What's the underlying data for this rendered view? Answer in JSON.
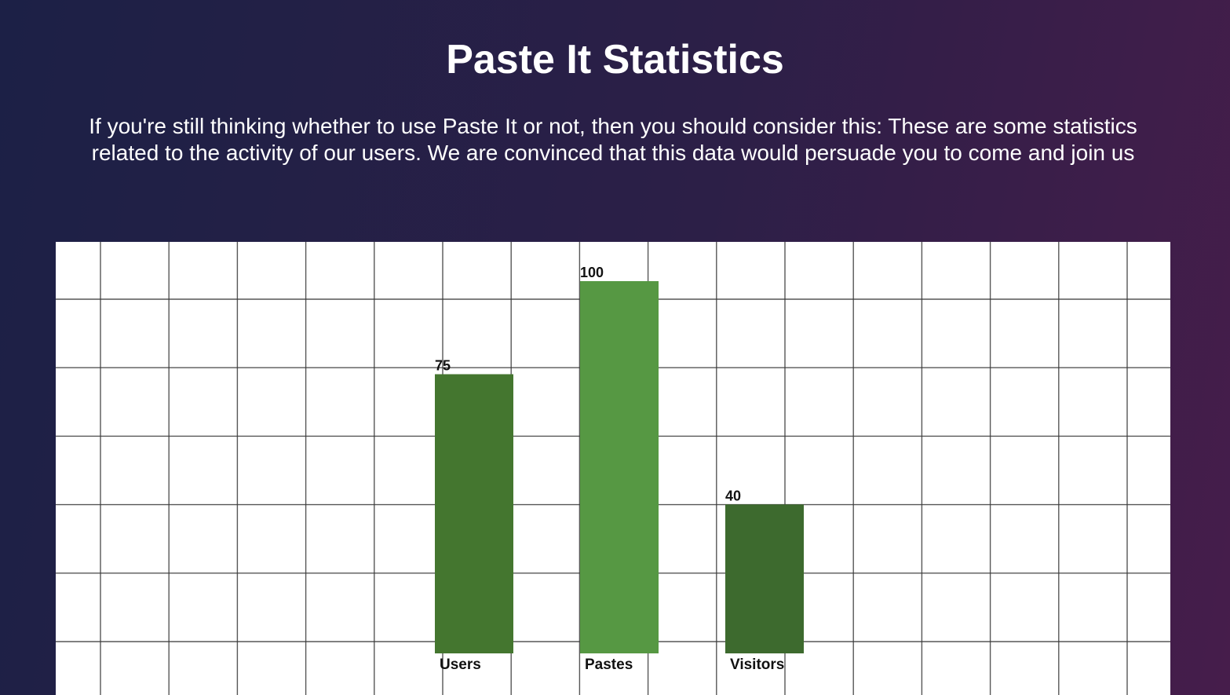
{
  "page": {
    "title": "Paste It Statistics",
    "intro": "If you're still thinking whether to use Paste It or not, then you should consider this: These are some statistics related to the activity of our users. We are convinced that this data would persuade you to come and join us"
  },
  "chart_data": {
    "type": "bar",
    "title": "",
    "xlabel": "",
    "ylabel": "",
    "categories": [
      "Users",
      "Pastes",
      "Visitors"
    ],
    "values": [
      75,
      100,
      40
    ],
    "ylim": [
      0,
      115
    ],
    "grid": true,
    "colors": [
      "#44762f",
      "#569843",
      "#3d6a2e"
    ],
    "background": "#ffffff",
    "grid_color": "#3a3a3a"
  },
  "colors": {
    "background_start": "#1c2046",
    "background_end": "#461d4b",
    "text": "#ffffff"
  }
}
